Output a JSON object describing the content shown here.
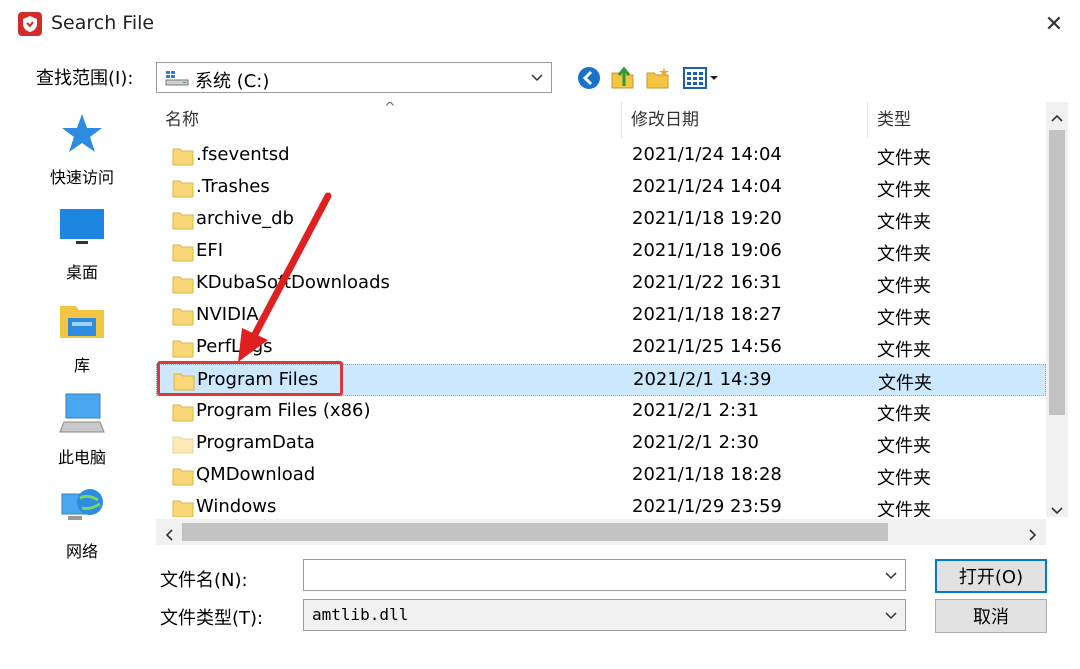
{
  "window": {
    "title": "Search File",
    "close_glyph": "✕"
  },
  "lookin": {
    "label": "查找范围(I):",
    "value": "系统 (C:)"
  },
  "toolbar": {
    "icons": [
      "back-icon",
      "up-folder-icon",
      "new-folder-icon",
      "view-menu-icon"
    ]
  },
  "places": [
    {
      "label": "快速访问",
      "icon": "star-icon"
    },
    {
      "label": "桌面",
      "icon": "desktop-icon"
    },
    {
      "label": "库",
      "icon": "library-icon"
    },
    {
      "label": "此电脑",
      "icon": "computer-icon"
    },
    {
      "label": "网络",
      "icon": "network-icon"
    }
  ],
  "columns": {
    "name": "名称",
    "date": "修改日期",
    "type": "类型"
  },
  "files": [
    {
      "name": ".fseventsd",
      "date": "2021/1/24 14:04",
      "type": "文件夹",
      "selected": false
    },
    {
      "name": ".Trashes",
      "date": "2021/1/24 14:04",
      "type": "文件夹",
      "selected": false
    },
    {
      "name": "archive_db",
      "date": "2021/1/18 19:20",
      "type": "文件夹",
      "selected": false
    },
    {
      "name": "EFI",
      "date": "2021/1/18 19:06",
      "type": "文件夹",
      "selected": false
    },
    {
      "name": "KDubaSoftDownloads",
      "date": "2021/1/22 16:31",
      "type": "文件夹",
      "selected": false
    },
    {
      "name": "NVIDIA",
      "date": "2021/1/18 18:27",
      "type": "文件夹",
      "selected": false
    },
    {
      "name": "PerfLogs",
      "date": "2021/1/25 14:56",
      "type": "文件夹",
      "selected": false
    },
    {
      "name": "Program Files",
      "date": "2021/2/1 14:39",
      "type": "文件夹",
      "selected": true
    },
    {
      "name": "Program Files (x86)",
      "date": "2021/2/1 2:31",
      "type": "文件夹",
      "selected": false
    },
    {
      "name": "ProgramData",
      "date": "2021/2/1 2:30",
      "type": "文件夹",
      "selected": false
    },
    {
      "name": "QMDownload",
      "date": "2021/1/18 18:28",
      "type": "文件夹",
      "selected": false
    },
    {
      "name": "Windows",
      "date": "2021/1/29 23:59",
      "type": "文件夹",
      "selected": false
    }
  ],
  "filename": {
    "label": "文件名(N):",
    "value": ""
  },
  "filetype": {
    "label": "文件类型(T):",
    "value": "amtlib.dll"
  },
  "buttons": {
    "open": "打开(O)",
    "cancel": "取消"
  },
  "colors": {
    "selection": "#cce8ff",
    "highlight_box": "#d83a3a",
    "arrow": "#e02020",
    "accent": "#0078d7"
  }
}
